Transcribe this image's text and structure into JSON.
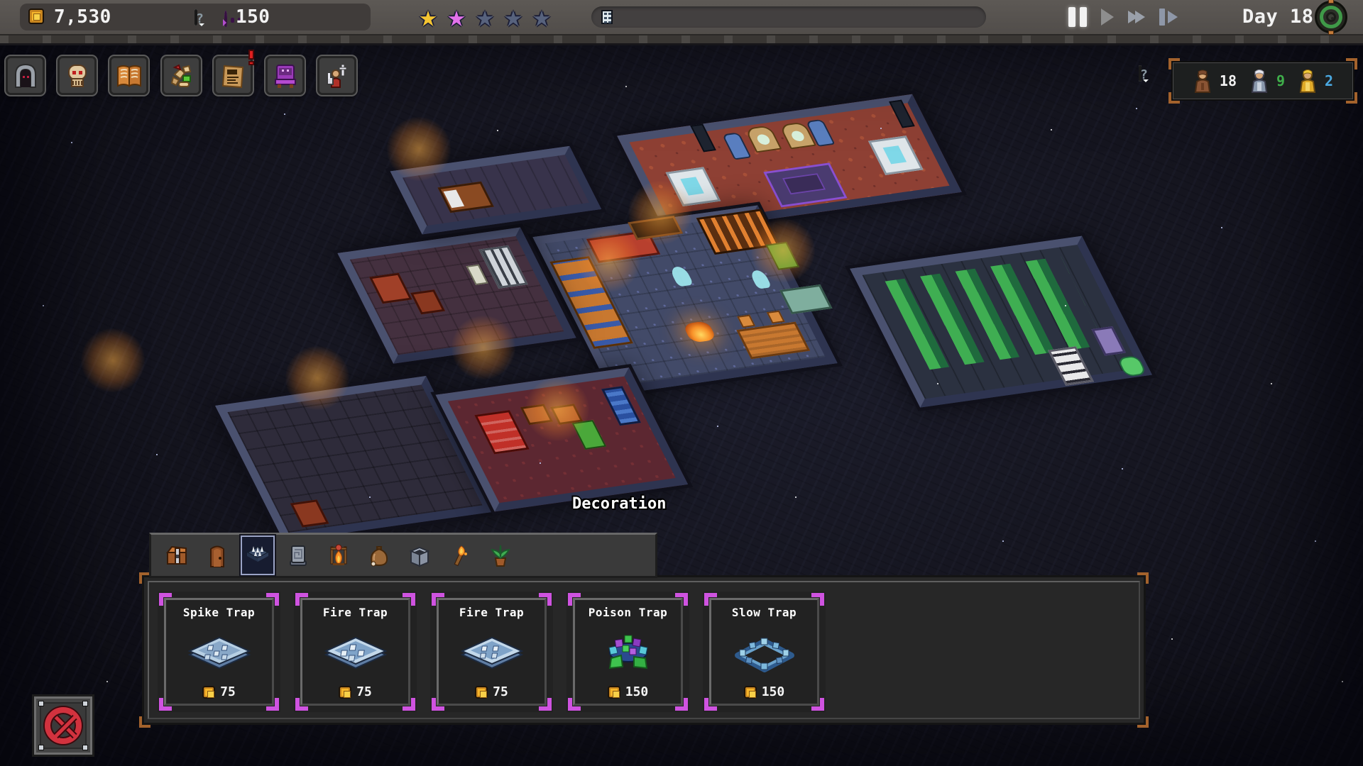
{
  "top_bar": {
    "gold": "7,530",
    "gold_icon": "coin-icon",
    "souls": "150",
    "souls_icon": "ghost-icon",
    "souls_hint_icon": "question-bubble-icon",
    "stars": [
      {
        "state": "gold"
      },
      {
        "state": "pink"
      },
      {
        "state": "empty"
      },
      {
        "state": "empty"
      },
      {
        "state": "empty"
      }
    ],
    "progress_bar": {
      "icon": "scroll-icon",
      "fill_percent": 0
    },
    "playback": [
      {
        "id": "pause",
        "active": true
      },
      {
        "id": "play",
        "active": false
      },
      {
        "id": "fast-forward",
        "active": false
      },
      {
        "id": "step-forward",
        "active": false
      }
    ],
    "day_label": "Day 18",
    "settings_icon": "gear-icon"
  },
  "toolbar": {
    "buttons": [
      {
        "name": "dungeon-gate"
      },
      {
        "name": "skull"
      },
      {
        "name": "codex-book"
      },
      {
        "name": "resources"
      },
      {
        "name": "contracts",
        "notification": true
      },
      {
        "name": "throne"
      },
      {
        "name": "heroes"
      }
    ]
  },
  "population": {
    "hint_icon": "question-bubble-icon",
    "groups": [
      {
        "icon": "worker-figure",
        "count": "18",
        "count_color": "#f2f2f2"
      },
      {
        "icon": "elder-figure",
        "count": "9",
        "count_color": "#3fae4a"
      },
      {
        "icon": "knight-figure",
        "count": "2",
        "count_color": "#4aa8e0"
      }
    ]
  },
  "tooltip": {
    "text": "Decoration"
  },
  "shop_panel": {
    "tabs": [
      {
        "name": "chest",
        "selected": false
      },
      {
        "name": "door",
        "selected": false
      },
      {
        "name": "spike-trap",
        "selected": true
      },
      {
        "name": "pressure-plate",
        "selected": false
      },
      {
        "name": "campfire",
        "selected": false
      },
      {
        "name": "sack",
        "selected": false
      },
      {
        "name": "furnace",
        "selected": false
      },
      {
        "name": "torch",
        "selected": false
      },
      {
        "name": "plant",
        "selected": false
      }
    ],
    "cards": [
      {
        "title": "Spike Trap",
        "price": "75",
        "icon": "steel-plate-trap"
      },
      {
        "title": "Fire Trap",
        "price": "75",
        "icon": "steel-plate-trap"
      },
      {
        "title": "Fire Trap",
        "price": "75",
        "icon": "steel-plate-trap"
      },
      {
        "title": "Poison Trap",
        "price": "150",
        "icon": "poison-crystal-trap"
      },
      {
        "title": "Slow Trap",
        "price": "150",
        "icon": "slow-crystal-trap"
      }
    ]
  },
  "close_button": {
    "icon": "cancel-x-icon"
  },
  "palette": {
    "topbar_bg": "#565250",
    "pill_bg": "#403c3a",
    "gold_coin": "#f6b62b",
    "soul_purple": "#b14ecb",
    "star_gold": "#f4c531",
    "star_pink": "#e372ea",
    "star_empty": "#57627d",
    "panel_bg": "#272727",
    "card_corner_magenta": "#cf53e0",
    "panel_corner_copper": "#a3622c",
    "count_green": "#3fae4a",
    "count_blue": "#4aa8e0",
    "close_red": "#d2323e",
    "scene_base": "#15151f",
    "wall_top": "#4a516f",
    "floor_ritual": "#8e4034",
    "floor_tavern": "#424a68",
    "floor_armory": "#5c2731",
    "crop_green": "#3fae52"
  }
}
